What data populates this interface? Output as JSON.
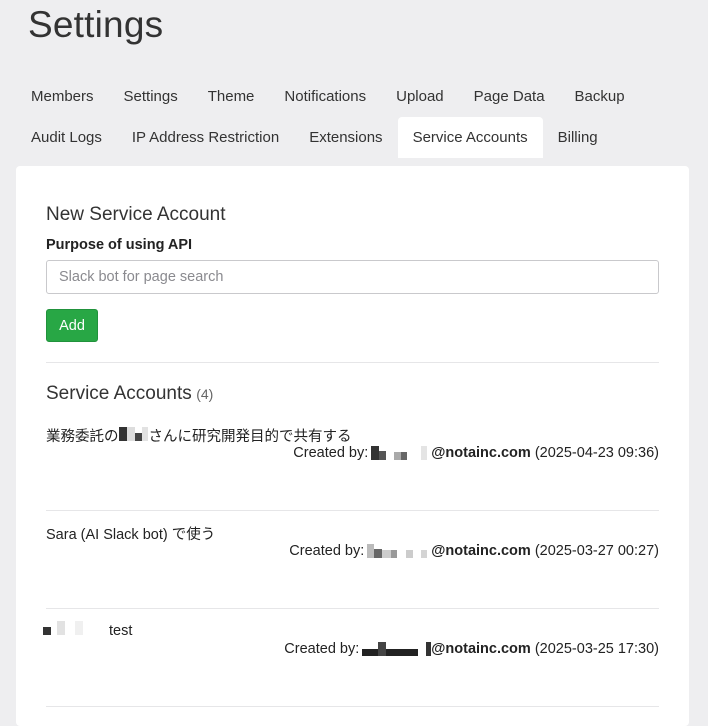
{
  "page": {
    "title": "Settings"
  },
  "tabs": {
    "row1": [
      {
        "label": "Members"
      },
      {
        "label": "Settings"
      },
      {
        "label": "Theme"
      },
      {
        "label": "Notifications"
      },
      {
        "label": "Upload"
      },
      {
        "label": "Page Data"
      },
      {
        "label": "Backup"
      }
    ],
    "row2": [
      {
        "label": "Audit Logs"
      },
      {
        "label": "IP Address Restriction"
      },
      {
        "label": "Extensions"
      },
      {
        "label": "Service Accounts",
        "active": true
      },
      {
        "label": "Billing"
      }
    ]
  },
  "new_account": {
    "title": "New Service Account",
    "purpose_label": "Purpose of using API",
    "purpose_placeholder": "Slack bot for page search",
    "purpose_value": "",
    "add_label": "Add"
  },
  "service_accounts": {
    "title": "Service Accounts",
    "count": "(4)",
    "created_by_label": "Created by:",
    "items": [
      {
        "purpose_prefix": "業務委託の",
        "purpose_suffix": "さんに研究開発目的で共有する",
        "email_domain": "@notainc.com",
        "created_at": "(2025-04-23 09:36)"
      },
      {
        "purpose_prefix": "Sara (AI Slack bot) で使う",
        "purpose_suffix": "",
        "email_domain": "@notainc.com",
        "created_at": "(2025-03-27 00:27)"
      },
      {
        "purpose_prefix": "",
        "purpose_suffix": "test",
        "email_domain": "@notainc.com",
        "created_at": "(2025-03-25 17:30)"
      }
    ]
  },
  "colors": {
    "background": "#eeeef0",
    "card": "#ffffff",
    "add_button": "#28a745",
    "redaction_dark": "#333333",
    "redaction_light": "#d8d8d8"
  }
}
